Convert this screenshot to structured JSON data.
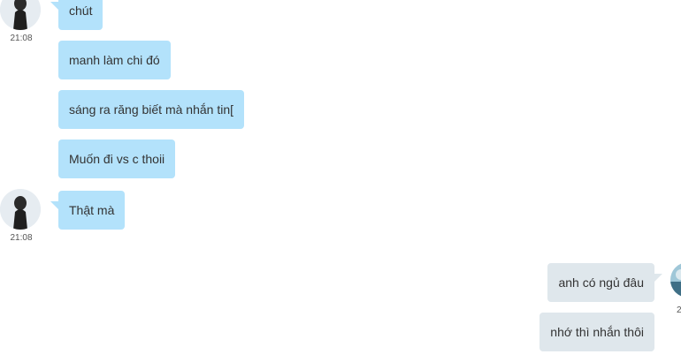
{
  "colors": {
    "incoming_bubble": "#b3e2fb",
    "outgoing_bubble": "#dfe7ec",
    "text": "#333333"
  },
  "messages": [
    {
      "direction": "incoming",
      "text": "chút",
      "avatar": "user-avatar-icon",
      "time": "21:08"
    },
    {
      "direction": "incoming",
      "text": "manh làm chi đó"
    },
    {
      "direction": "incoming",
      "text": "sáng ra răng biết mà nhắn tin["
    },
    {
      "direction": "incoming",
      "text": "Muốn đi vs c thoii"
    },
    {
      "direction": "incoming",
      "text": "Thật mà",
      "avatar": "user-avatar-icon",
      "time": "21:08"
    },
    {
      "direction": "outgoing",
      "text": "anh có ngủ đâu",
      "avatar": "self-avatar-icon",
      "time": "2"
    },
    {
      "direction": "outgoing",
      "text": "nhớ thì nhắn thôi"
    }
  ]
}
